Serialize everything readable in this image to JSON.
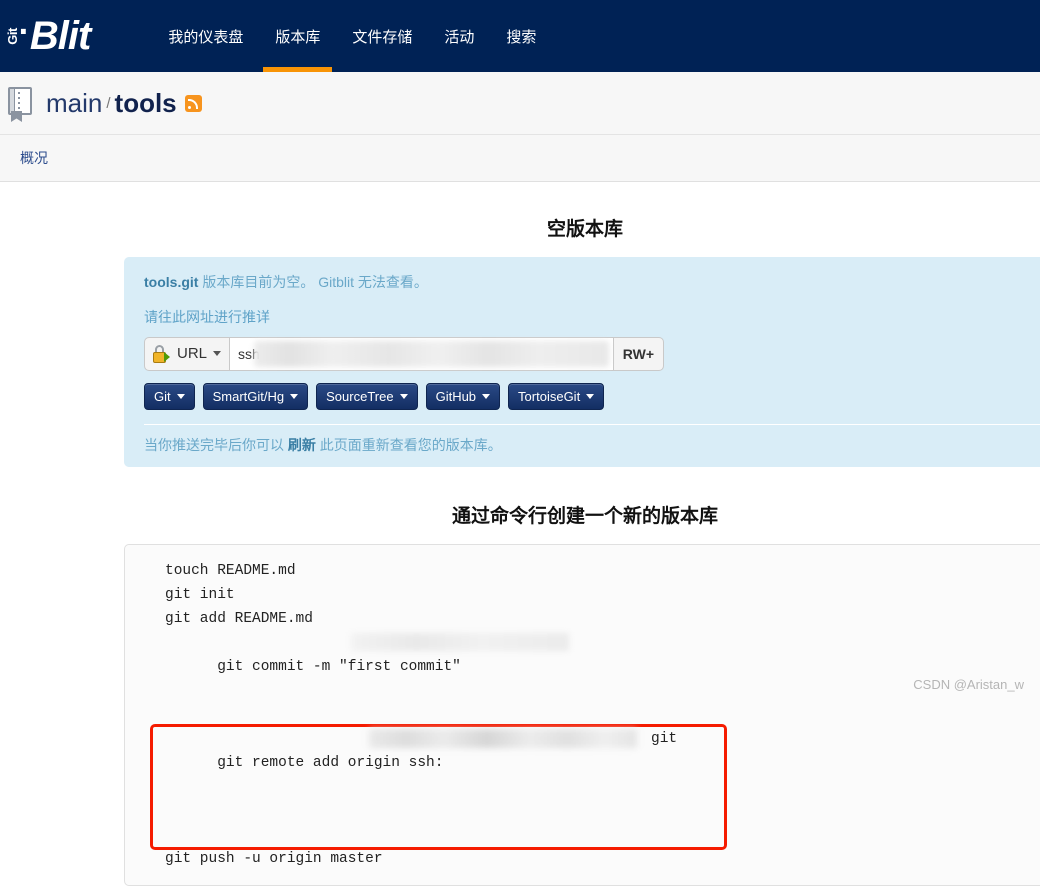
{
  "navbar": {
    "brand": {
      "git": "Git",
      "dot": "·",
      "blit": "Blit"
    },
    "items": [
      {
        "label": "我的仪表盘",
        "name": "nav-dashboard",
        "active": false
      },
      {
        "label": "版本库",
        "name": "nav-repositories",
        "active": true
      },
      {
        "label": "文件存储",
        "name": "nav-filestore",
        "active": false
      },
      {
        "label": "活动",
        "name": "nav-activity",
        "active": false
      },
      {
        "label": "搜索",
        "name": "nav-search",
        "active": false
      }
    ],
    "accent_color": "#f89406",
    "background_color": "#002255"
  },
  "breadcrumb": {
    "project": "main",
    "separator": "/",
    "repository": "tools",
    "rss_icon": "rss-icon"
  },
  "tabs": [
    {
      "label": "概况",
      "name": "tab-overview"
    }
  ],
  "empty_repo": {
    "title": "空版本库",
    "repo_name": "tools.git",
    "message_rest": " 版本库目前为空。  Gitblit 无法查看。",
    "push_hint": "请往此网址进行推详",
    "url_selector_label": "URL",
    "url_value": "ssh",
    "url_placeholder": "ssh://",
    "access_badge": "RW+",
    "clients": [
      {
        "label": "Git",
        "name": "client-git"
      },
      {
        "label": "SmartGit/Hg",
        "name": "client-smartgit-hg"
      },
      {
        "label": "SourceTree",
        "name": "client-sourcetree"
      },
      {
        "label": "GitHub",
        "name": "client-github"
      },
      {
        "label": "TortoiseGit",
        "name": "client-tortoisegit"
      }
    ],
    "footer_pre": "当你推送完毕后你可以 ",
    "footer_link": "刷新",
    "footer_post": " 此页面重新查看您的版本库。",
    "panel_color": "#d9edf7"
  },
  "cmdline": {
    "title": "通过命令行创建一个新的版本库",
    "lines": [
      {
        "text": "touch README.md",
        "highlight": false,
        "redacted": false
      },
      {
        "text": "git init",
        "highlight": false,
        "redacted": false
      },
      {
        "text": "git add README.md",
        "highlight": false,
        "redacted": false
      },
      {
        "text": "git commit -m ″first commit″",
        "highlight": false,
        "redacted": true
      },
      {
        "text": "git remote add origin ssh:",
        "suffix": "git",
        "highlight": true,
        "redacted": true
      },
      {
        "text": "git push -u origin master",
        "highlight": false,
        "redacted": false
      }
    ],
    "highlight_color": "#f51b00"
  },
  "watermark": "CSDN @Aristan_w"
}
